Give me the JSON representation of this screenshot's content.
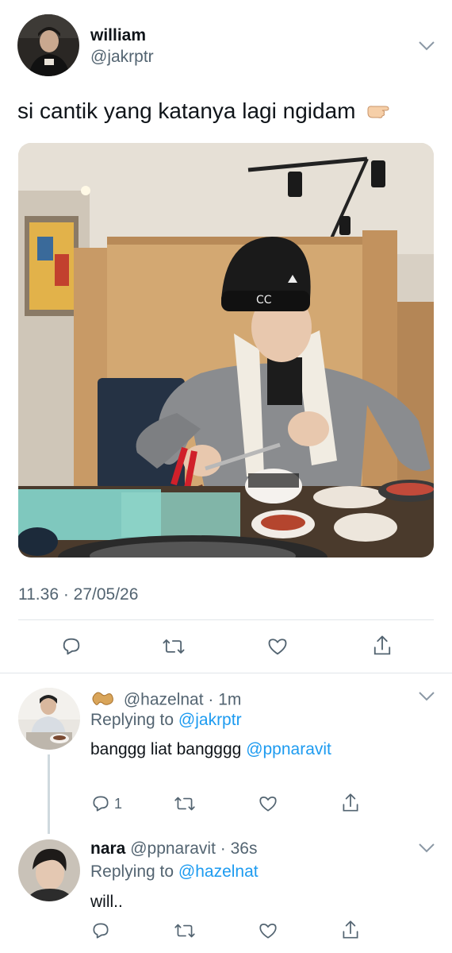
{
  "main_tweet": {
    "name": "william",
    "handle": "@jakrptr",
    "text": "si cantik yang katanya lagi ngidam",
    "emoji": "pointing-hand-emoji",
    "timestamp": "11.36 · 27/05/26"
  },
  "replies": [
    {
      "emoji_prefix": "peanut-emoji",
      "name": "",
      "handle": "@hazelnat",
      "time": "1m",
      "replying_label": "Replying to",
      "replying_to": "@jakrptr",
      "text": "banggg liat bangggg",
      "mention": "@ppnaravit",
      "reply_count": "1"
    },
    {
      "name": "nara",
      "handle": "@ppnaravit",
      "time": "36s",
      "replying_label": "Replying to",
      "replying_to": "@hazelnat",
      "text": "will..",
      "reply_count": ""
    }
  ],
  "colors": {
    "text": "#0f1419",
    "muted": "#536471",
    "link": "#1d9bf0",
    "divider": "#e1e6ea"
  },
  "icons": [
    "reply-icon",
    "retweet-icon",
    "like-icon",
    "share-icon",
    "chevron-down-icon"
  ]
}
